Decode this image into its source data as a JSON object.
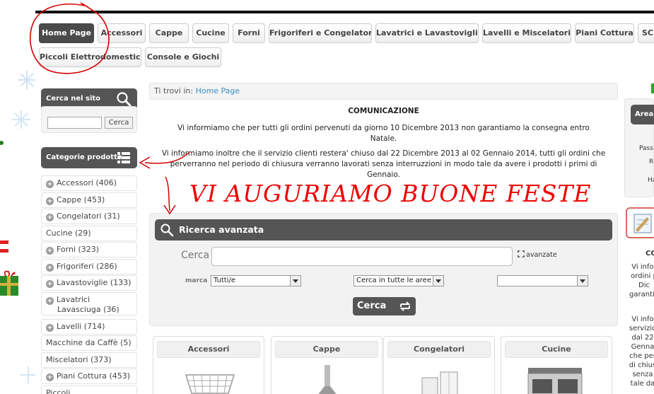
{
  "nav": {
    "items": [
      {
        "label": "Home Page",
        "active": true
      },
      {
        "label": "Accessori"
      },
      {
        "label": "Cappe"
      },
      {
        "label": "Cucine"
      },
      {
        "label": "Forni"
      },
      {
        "label": "Frigoriferi e Congelatori"
      },
      {
        "label": "Lavatrici e Lavastoviglie"
      },
      {
        "label": "Lavelli e Miscelatori"
      },
      {
        "label": "Piani Cottura"
      },
      {
        "label": "SC"
      },
      {
        "label": "Piccoli Elettrodomestici"
      },
      {
        "label": "Console e Giochi"
      }
    ]
  },
  "site_search": {
    "title": "Cerca nel sito",
    "button": "Cerca"
  },
  "categories": {
    "title": "Categorie prodotto",
    "items": [
      {
        "label": "Accessori (406)",
        "expandable": true
      },
      {
        "label": "Cappe (453)",
        "expandable": true
      },
      {
        "label": "Congelatori (31)",
        "expandable": true
      },
      {
        "label": "Cucine (29)",
        "expandable": false
      },
      {
        "label": "Forni (323)",
        "expandable": true
      },
      {
        "label": "Frigoriferi (286)",
        "expandable": true
      },
      {
        "label": "Lavastoviglie (133)",
        "expandable": true
      },
      {
        "label": "Lavatrici Lavasciuga (36)",
        "expandable": true
      },
      {
        "label": "Lavelli (714)",
        "expandable": true
      },
      {
        "label": "Macchine da Caffè (5)",
        "expandable": false
      },
      {
        "label": "Miscelatori (373)",
        "expandable": false
      },
      {
        "label": "Piani Cottura (453)",
        "expandable": true
      },
      {
        "label": "Piccoli Elettrodomestici",
        "expandable": false
      }
    ]
  },
  "breadcrumb": {
    "prefix": "Ti trovi in:",
    "current": "Home Page"
  },
  "notice": {
    "title": "COMUNICAZIONE",
    "p1": "Vi informiamo che per tutti gli ordini pervenuti da giorno 10 Dicembre 2013 non garantiamo la consegna entro Natale.",
    "p2": "Vi informiamo inoltre che il servizio clienti restera' chiuso dal 22 Dicembre 2013 al 02 Gennaio 2014, tutti gli ordini che perverranno nel periodo di chiusura verranno lavorati senza interruzzioni in modo tale da avere i prodotti i primi di Gennaio."
  },
  "greeting": "VI AUGURIAMO BUONE FESTE",
  "advanced_search": {
    "title": "Ricerca avanzata",
    "search_label": "Cerca",
    "advanced_link": "avanzate",
    "brand_label": "marca",
    "brand_value": "Tutti/e",
    "area_value": "Cerca in tutte le aree",
    "third_value": "",
    "submit": "Cerca"
  },
  "products": [
    {
      "label": "Accessori"
    },
    {
      "label": "Cappe"
    },
    {
      "label": "Congelatori"
    },
    {
      "label": "Cucine"
    }
  ],
  "right_column": {
    "area_label": "Area",
    "frag1": "Pass",
    "frag2": "R",
    "frag3": "Ha",
    "co": "CO",
    "lines": [
      "Vi infor",
      "ordini p",
      "Dic",
      "garantia"
    ],
    "lines2": [
      "Vi info",
      "servizio",
      "dal 22",
      "Genna",
      "che per",
      "di chius",
      "senza",
      "tale da"
    ]
  },
  "colors": {
    "accent_link": "#3a8fc8",
    "header_bar": "#555555",
    "annotation_red": "#dd0000"
  }
}
